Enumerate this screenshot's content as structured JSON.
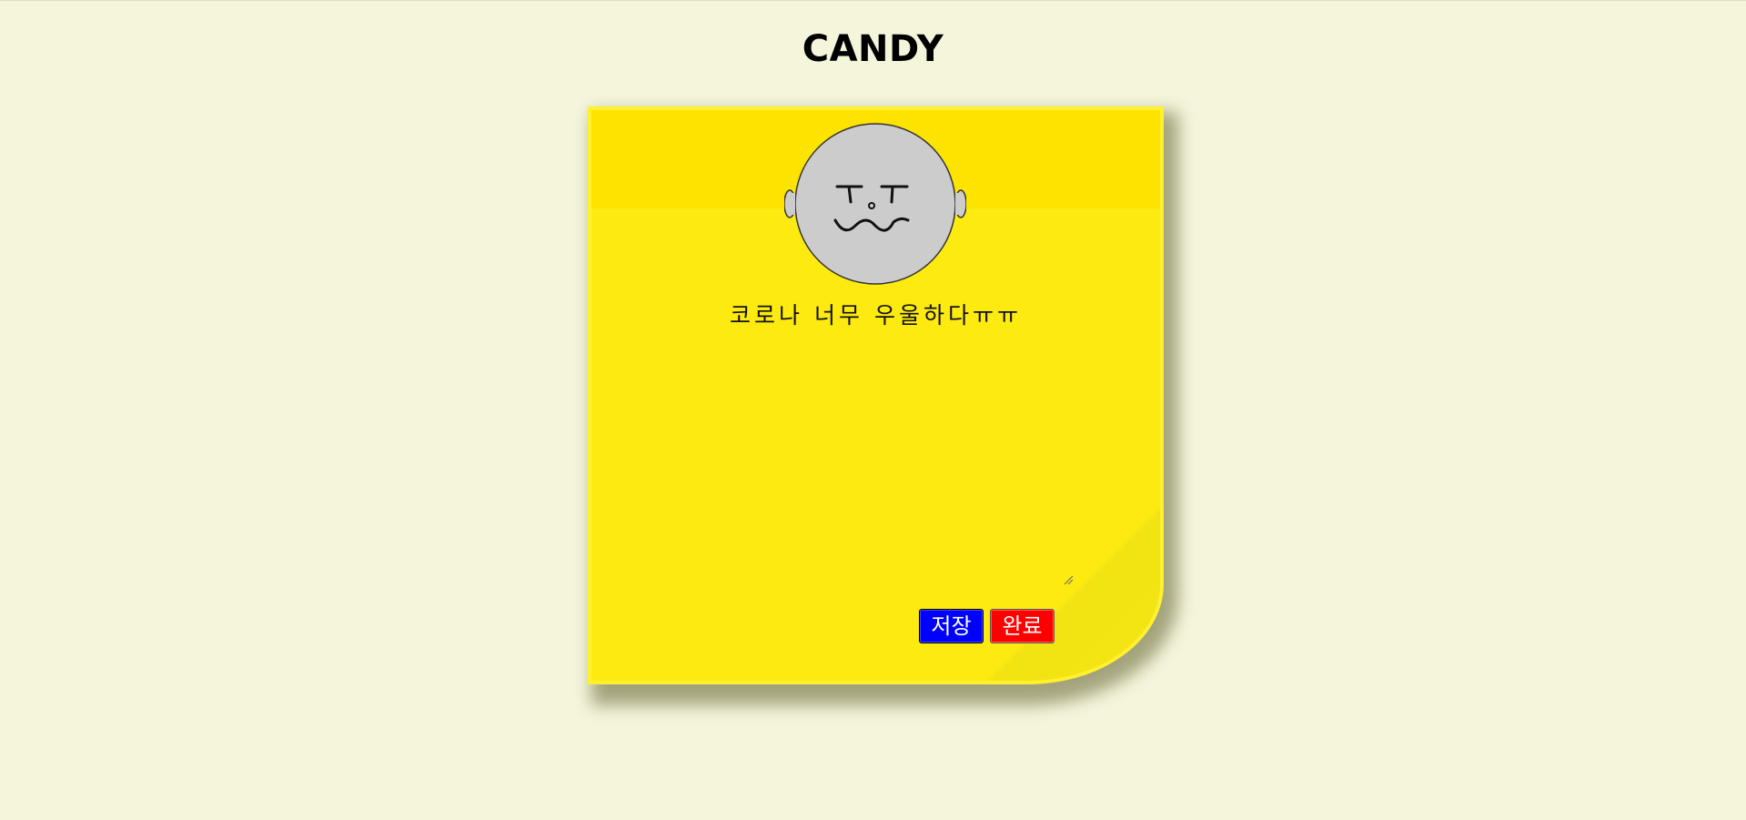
{
  "page": {
    "title": "CANDY"
  },
  "note": {
    "text": "코로나 너무 우울하다ㅠㅠ",
    "avatar_icon": "sad-face-avatar-icon"
  },
  "buttons": {
    "save_label": "저장",
    "done_label": "완료"
  },
  "colors": {
    "background": "#f5f5dc",
    "note": "#fdea11",
    "note_band": "#fde300",
    "save_button": "#0000ff",
    "done_button": "#ff0000",
    "avatar": "#cccccc"
  }
}
